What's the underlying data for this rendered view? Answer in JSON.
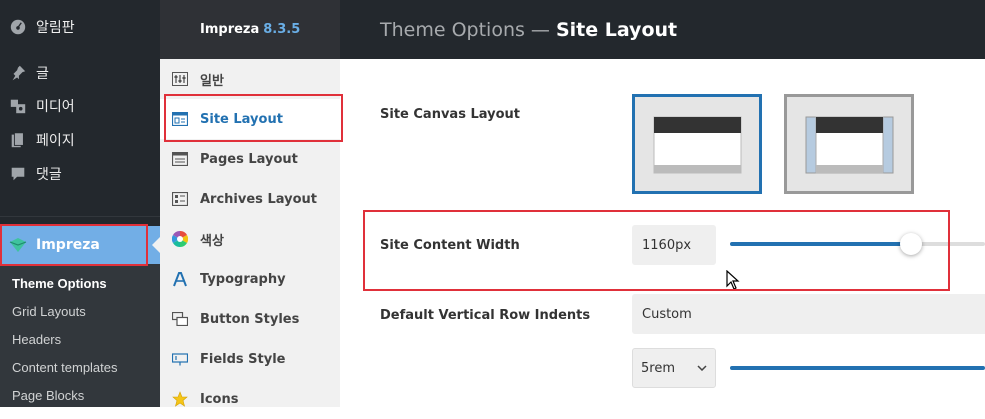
{
  "wp_menu": {
    "items": [
      {
        "label": "알림판",
        "icon": "dashboard-icon"
      },
      {
        "label": "글",
        "icon": "pin-icon"
      },
      {
        "label": "미디어",
        "icon": "media-icon"
      },
      {
        "label": "페이지",
        "icon": "pages-icon"
      },
      {
        "label": "댓글",
        "icon": "comments-icon"
      }
    ],
    "active": {
      "label": "Impreza",
      "icon": "impreza-icon"
    },
    "submenu": [
      "Theme Options",
      "Grid Layouts",
      "Headers",
      "Content templates",
      "Page Blocks"
    ]
  },
  "options_nav": {
    "brand": "Impreza",
    "version": "8.3.5",
    "items": [
      {
        "label": "일반",
        "icon": "sliders-icon"
      },
      {
        "label": "Site Layout",
        "icon": "layout-icon"
      },
      {
        "label": "Pages Layout",
        "icon": "page-layout-icon"
      },
      {
        "label": "Archives Layout",
        "icon": "archives-icon"
      },
      {
        "label": "색상",
        "icon": "color-wheel-icon"
      },
      {
        "label": "Typography",
        "icon": "typography-icon"
      },
      {
        "label": "Button Styles",
        "icon": "button-styles-icon"
      },
      {
        "label": "Fields Style",
        "icon": "fields-icon"
      },
      {
        "label": "Icons",
        "icon": "star-icon"
      }
    ]
  },
  "main": {
    "title_prefix": "Theme Options —",
    "title_current": "Site Layout",
    "canvas_layout_label": "Site Canvas Layout",
    "content_width_label": "Site Content Width",
    "content_width_value": "1160px",
    "row_indents_label": "Default Vertical Row Indents",
    "row_indents_value": "Custom",
    "indent_unit_value": "5rem"
  },
  "colors": {
    "accent": "#2271b1",
    "wp_active": "#72aee6",
    "highlight_red": "#e0303a"
  }
}
